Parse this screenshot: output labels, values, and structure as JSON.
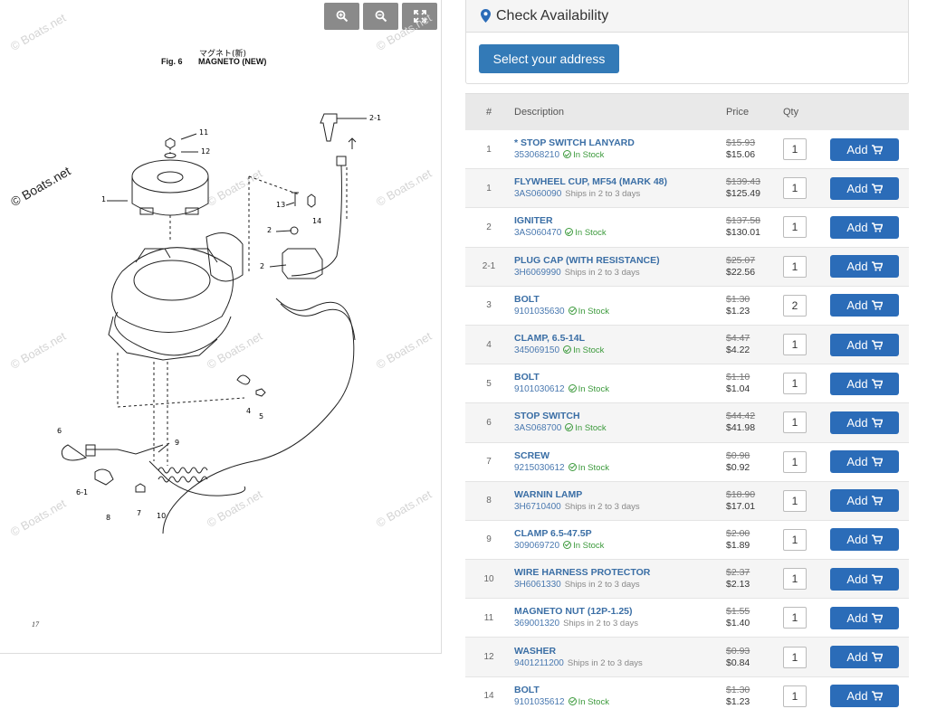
{
  "diagram": {
    "zoom_in_icon": "zoom-in-icon",
    "zoom_out_icon": "zoom-out-icon",
    "fullscreen_icon": "expand-icon",
    "jp_title": "マグネト(新)",
    "fig_number": "Fig. 6",
    "fig_title": "MAGNETO (NEW)",
    "page_number": "17",
    "watermark_dark": "© Boats.net",
    "watermark_light": "© Boats.net",
    "callouts": [
      "11",
      "12",
      "2-1",
      "13",
      "14",
      "2",
      "2",
      "1",
      "4",
      "5",
      "6",
      "6-1",
      "8",
      "7",
      "9",
      "10"
    ]
  },
  "availability": {
    "title": "Check Availability",
    "select_address": "Select your address"
  },
  "table": {
    "headers": {
      "num": "#",
      "desc": "Description",
      "price": "Price",
      "qty": "Qty"
    },
    "add_label": "Add",
    "rows": [
      {
        "num": "1",
        "name": "* STOP SWITCH LANYARD",
        "part": "353068210",
        "status": "In Stock",
        "was": "$15.93",
        "now": "$15.06",
        "qty": "1"
      },
      {
        "num": "1",
        "name": "FLYWHEEL CUP, MF54 (MARK 48)",
        "part": "3AS060090",
        "status": "Ships in 2 to 3 days",
        "was": "$139.43",
        "now": "$125.49",
        "qty": "1"
      },
      {
        "num": "2",
        "name": "IGNITER",
        "part": "3AS060470",
        "status": "In Stock",
        "was": "$137.58",
        "now": "$130.01",
        "qty": "1"
      },
      {
        "num": "2-1",
        "name": "PLUG CAP (WITH RESISTANCE)",
        "part": "3H6069990",
        "status": "Ships in 2 to 3 days",
        "was": "$25.07",
        "now": "$22.56",
        "qty": "1"
      },
      {
        "num": "3",
        "name": "BOLT",
        "part": "9101035630",
        "status": "In Stock",
        "was": "$1.30",
        "now": "$1.23",
        "qty": "2"
      },
      {
        "num": "4",
        "name": "CLAMP, 6.5-14L",
        "part": "345069150",
        "status": "In Stock",
        "was": "$4.47",
        "now": "$4.22",
        "qty": "1"
      },
      {
        "num": "5",
        "name": "BOLT",
        "part": "9101030612",
        "status": "In Stock",
        "was": "$1.10",
        "now": "$1.04",
        "qty": "1"
      },
      {
        "num": "6",
        "name": "STOP SWITCH",
        "part": "3AS068700",
        "status": "In Stock",
        "was": "$44.42",
        "now": "$41.98",
        "qty": "1"
      },
      {
        "num": "7",
        "name": "SCREW",
        "part": "9215030612",
        "status": "In Stock",
        "was": "$0.98",
        "now": "$0.92",
        "qty": "1"
      },
      {
        "num": "8",
        "name": "WARNIN LAMP",
        "part": "3H6710400",
        "status": "Ships in 2 to 3 days",
        "was": "$18.90",
        "now": "$17.01",
        "qty": "1"
      },
      {
        "num": "9",
        "name": "CLAMP 6.5-47.5P",
        "part": "309069720",
        "status": "In Stock",
        "was": "$2.00",
        "now": "$1.89",
        "qty": "1"
      },
      {
        "num": "10",
        "name": "WIRE HARNESS PROTECTOR",
        "part": "3H6061330",
        "status": "Ships in 2 to 3 days",
        "was": "$2.37",
        "now": "$2.13",
        "qty": "1"
      },
      {
        "num": "11",
        "name": "MAGNETO NUT (12P-1.25)",
        "part": "369001320",
        "status": "Ships in 2 to 3 days",
        "was": "$1.55",
        "now": "$1.40",
        "qty": "1"
      },
      {
        "num": "12",
        "name": "WASHER",
        "part": "9401211200",
        "status": "Ships in 2 to 3 days",
        "was": "$0.93",
        "now": "$0.84",
        "qty": "1"
      },
      {
        "num": "14",
        "name": "BOLT",
        "part": "9101035612",
        "status": "In Stock",
        "was": "$1.30",
        "now": "$1.23",
        "qty": "1"
      }
    ]
  },
  "colors": {
    "primary": "#2b6cb8",
    "address_button": "#337ab7",
    "in_stock": "#3c9a3c",
    "part_name": "#3a6ea5"
  }
}
